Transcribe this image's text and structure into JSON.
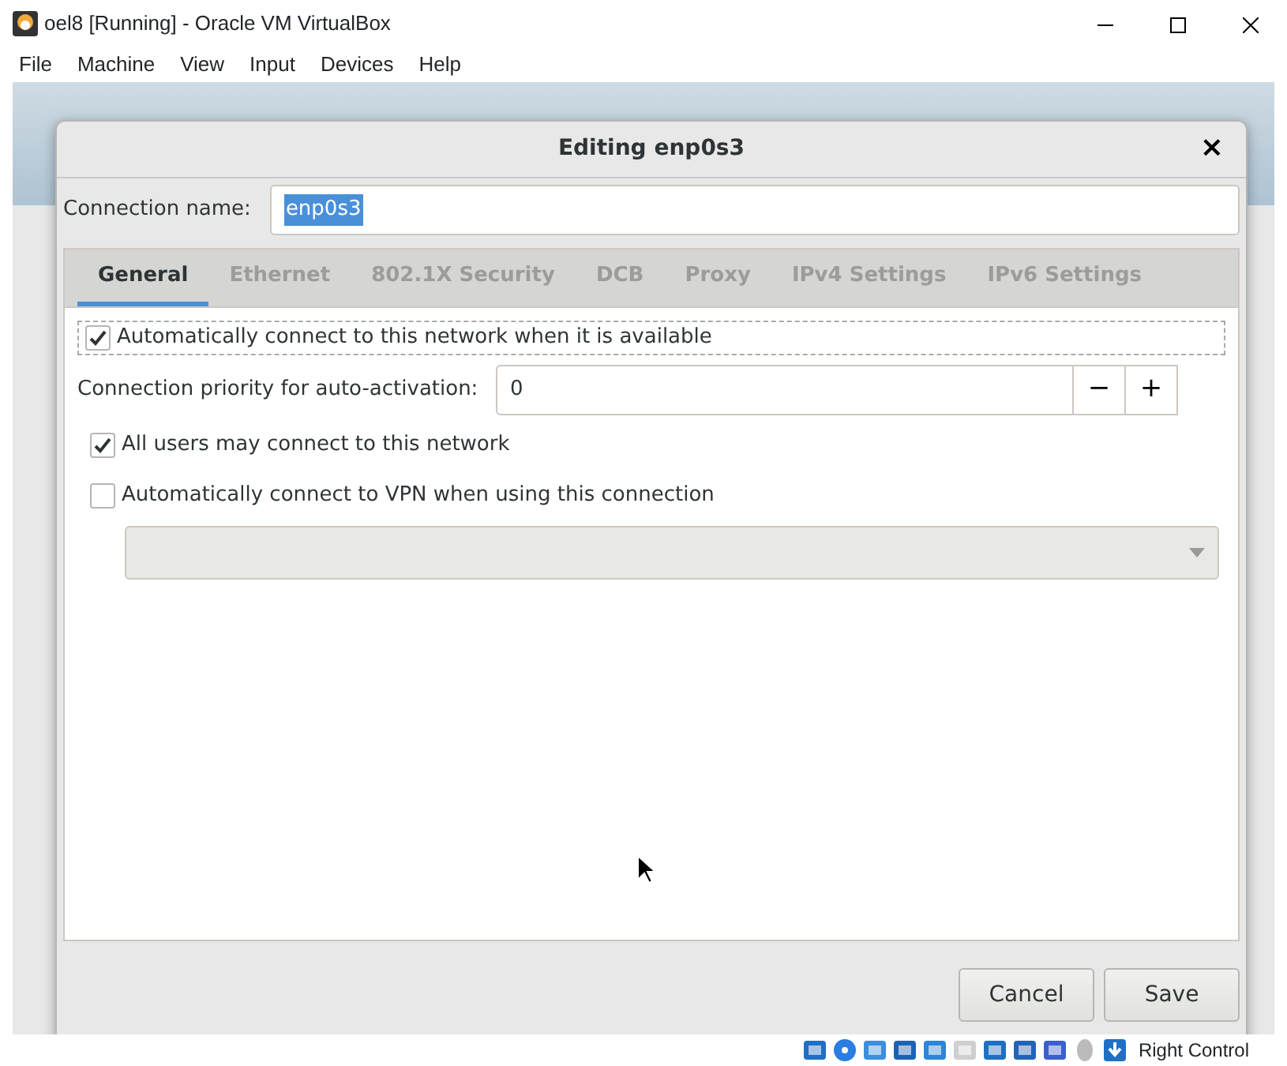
{
  "window": {
    "title": "oel8 [Running] - Oracle VM VirtualBox"
  },
  "menu": [
    "File",
    "Machine",
    "View",
    "Input",
    "Devices",
    "Help"
  ],
  "dialog": {
    "title": "Editing enp0s3",
    "close": "×",
    "connection_name": {
      "label": "Connection name:",
      "value": "enp0s3",
      "value_selected": true
    },
    "tabs": [
      {
        "label": "General",
        "selected": true
      },
      {
        "label": "Ethernet",
        "selected": false
      },
      {
        "label": "802.1X Security",
        "selected": false
      },
      {
        "label": "DCB",
        "selected": false
      },
      {
        "label": "Proxy",
        "selected": false
      },
      {
        "label": "IPv4 Settings",
        "selected": false
      },
      {
        "label": "IPv6 Settings",
        "selected": false
      }
    ],
    "general": [
      {
        "kind": "checkbox",
        "label": "Automatically connect to this network when it is available",
        "checked": true,
        "focused": true
      },
      {
        "kind": "spin",
        "label": "Connection priority for auto-activation:",
        "value": "0",
        "minus": "−",
        "plus": "+"
      },
      {
        "kind": "checkbox",
        "label": "All users may connect to this network",
        "checked": true,
        "focused": false
      },
      {
        "kind": "checkbox",
        "label": "Automatically connect to VPN when using this connection",
        "checked": false,
        "focused": false
      },
      {
        "kind": "dropdown",
        "disabled": true
      }
    ],
    "buttons": [
      {
        "label": "Cancel"
      },
      {
        "label": "Save"
      }
    ]
  },
  "status_bar": {
    "host_key": "Right Control"
  }
}
